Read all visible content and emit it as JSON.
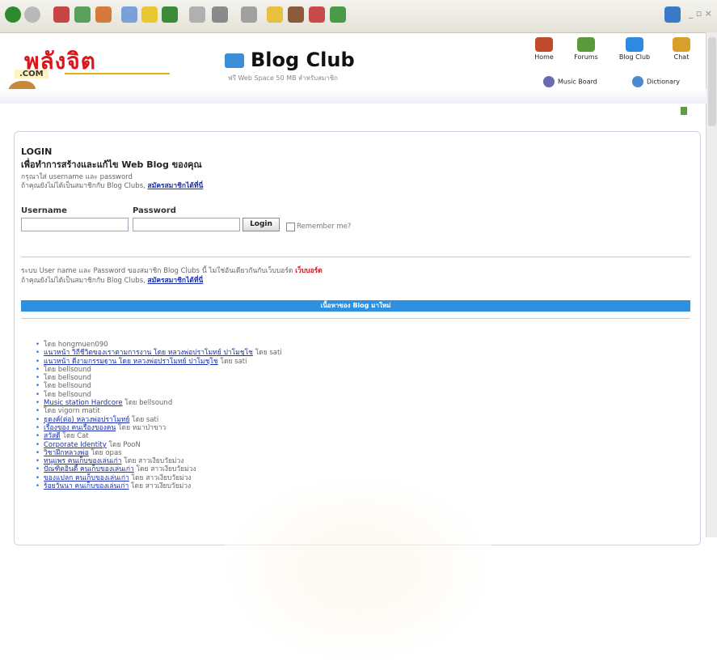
{
  "header": {
    "logo_thai": "พลังจิต",
    "logo_sub": ".COM",
    "blog_title": "Blog Club",
    "blog_sub": "ฟรี Web Space 50 MB สำหรับสมาชิก",
    "nav": [
      {
        "label": "Home",
        "icon": "home-icon",
        "color": "#c04a2a"
      },
      {
        "label": "Forums",
        "icon": "forums-icon",
        "color": "#5a9a3a"
      },
      {
        "label": "Blog Club",
        "icon": "blog-icon",
        "color": "#2e8ae0"
      },
      {
        "label": "Chat",
        "icon": "chat-icon",
        "color": "#d8a02a"
      }
    ],
    "nav2": [
      {
        "label": "Music Board",
        "icon": "music-icon"
      },
      {
        "label": "Dictionary",
        "icon": "dictionary-icon"
      }
    ]
  },
  "login": {
    "title": "LOGIN",
    "desc": "เพื่อทำการสร้างและแก้ไข Web Blog ของคุณ",
    "hint1": "กรุณาใส่ username และ password",
    "hint2": "ถ้าคุณยังไม่ได้เป็นสมาชิกกับ Blog Clubs,",
    "register_link": "สมัครสมาชิกได้ที่นี่",
    "username_label": "Username",
    "password_label": "Password",
    "login_button": "Login",
    "remember_label": "Remember me?"
  },
  "notice": {
    "line1": "ระบบ User name และ Password ของสมาชิก Blog Clubs นี้ ไม่ใช่อันเดียวกันกับเว็บบอร์ด",
    "line1_red": "เว็บบอร์ด",
    "line2": "ถ้าคุณยังไม่ได้เป็นสมาชิกกับ Blog Clubs,",
    "link": "สมัครสมาชิกได้ที่นี่"
  },
  "section_bar": "เนื้อหาของ Blog มาใหม่",
  "entries": [
    {
      "title": "",
      "by": "โดย hongmuen090"
    },
    {
      "title": "แนวหน้า วิถีชีวิตของเราตามการงาน โดย หลวงพ่อปราโมทย์ ปาโมชฺโช",
      "by": "โดย sati"
    },
    {
      "title": "แนวหน้า ดีงามกรรมฐาน โดย หลวงพ่อปราโมทย์ ปาโมชฺโช",
      "by": "โดย sati"
    },
    {
      "title": "",
      "by": "โดย bellsound"
    },
    {
      "title": "",
      "by": "โดย bellsound"
    },
    {
      "title": "",
      "by": "โดย bellsound"
    },
    {
      "title": "",
      "by": "โดย bellsound"
    },
    {
      "title": "Music station Hardcore",
      "by": "โดย bellsound"
    },
    {
      "title": "",
      "by": "โดย vigorn matit"
    },
    {
      "title": "ธุดงค์(ต่อ) หลวงพ่อปราโมทย์",
      "by": "โดย sati"
    },
    {
      "title": "เรื่องของ คนเรื่องของคน",
      "by": "โดย หมาป่าขาว"
    },
    {
      "title": "สวัสดี",
      "by": "โดย Cat"
    },
    {
      "title": "Corporate Identity",
      "by": "โดย PooN"
    },
    {
      "title": "วิชาฝึกหลวงพ่อ",
      "by": "โดย opas"
    },
    {
      "title": "หนูแพร คนเก็บของเล่นเก่า",
      "by": "โดย สาวเงียบวัยม่วง"
    },
    {
      "title": "ปัณฑิตอินดี้ คนเก็บของเล่นเก่า",
      "by": "โดย สาวเงียบวัยม่วง"
    },
    {
      "title": "ของแปลก คนเก็บของเล่นเก่า",
      "by": "โดย สาวเงียบวัยม่วง"
    },
    {
      "title": "ร้อยวันนา คนเก็บของเล่นเก่า",
      "by": "โดย สาวเงียบวัยม่วง"
    }
  ]
}
